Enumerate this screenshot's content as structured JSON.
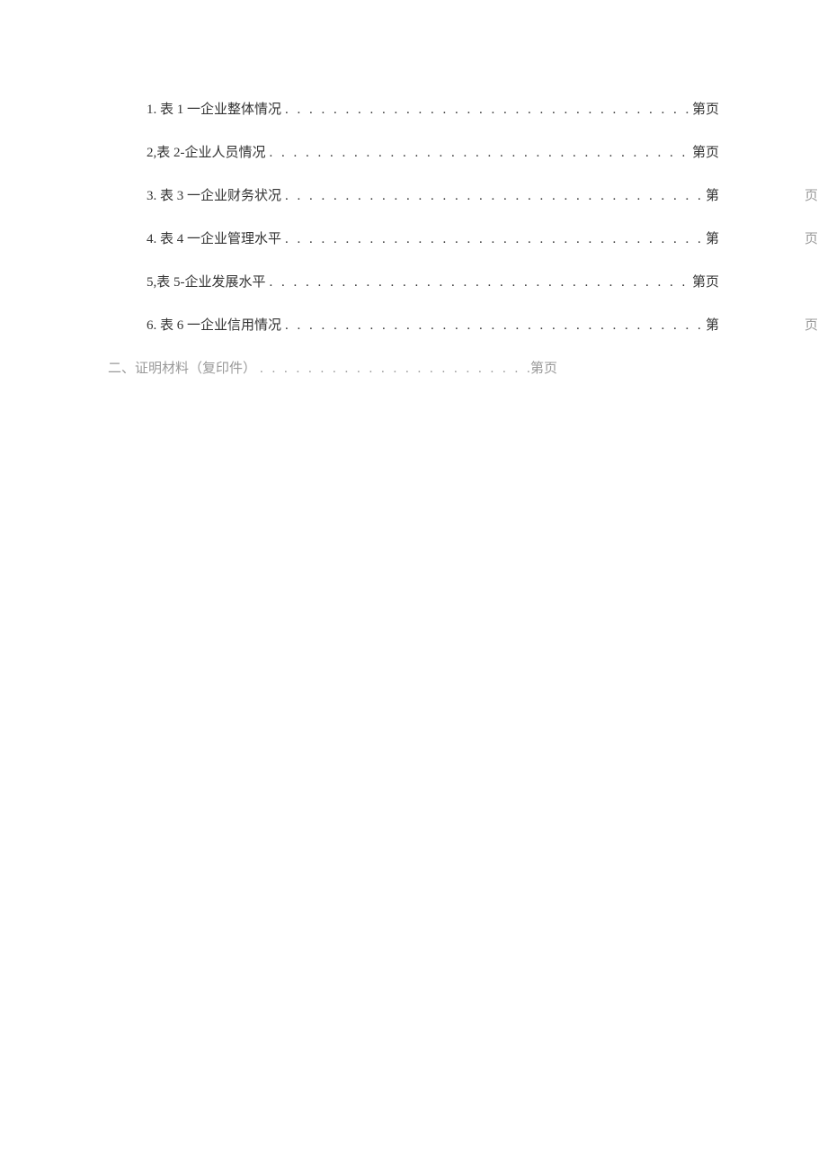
{
  "toc": {
    "items": [
      {
        "label": "1. 表 1 一企业整体情况",
        "tail": "第页",
        "far": false,
        "indented": true
      },
      {
        "label": "2,表 2-企业人员情况",
        "tail": "第页",
        "far": false,
        "indented": true
      },
      {
        "label": "3. 表 3 一企业财务状况",
        "tail": "第",
        "far_tail": "页",
        "far": true,
        "indented": true
      },
      {
        "label": "4. 表 4 一企业管理水平",
        "tail": "第",
        "far_tail": "页",
        "far": true,
        "indented": true
      },
      {
        "label": "5,表 5-企业发展水平",
        "tail": "第页",
        "far": false,
        "indented": true
      },
      {
        "label": "6. 表 6 一企业信用情况",
        "tail": "第",
        "far_tail": "页",
        "far": true,
        "indented": true
      },
      {
        "label": "二、证明材料（复印件）",
        "tail": "第页",
        "far": false,
        "indented": false
      }
    ]
  },
  "dots": ". . . . . . . . . . . . . . . . . . . . . . . . . . . . . . . . . . . . . . . . . . . . . . . . . . . . . . . . . . . . . . . . . . . . . ."
}
